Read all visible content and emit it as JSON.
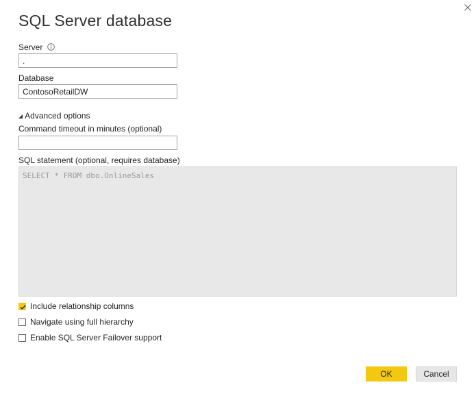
{
  "dialog": {
    "title": "SQL Server database"
  },
  "server": {
    "label": "Server",
    "value": "."
  },
  "database": {
    "label": "Database",
    "value": "ContosoRetailDW"
  },
  "advanced": {
    "toggle_label": "Advanced options",
    "timeout_label": "Command timeout in minutes (optional)",
    "timeout_value": "",
    "sql_label": "SQL statement (optional, requires database)",
    "sql_placeholder": "SELECT * FROM dbo.OnlineSales"
  },
  "options": [
    {
      "label": "Include relationship columns",
      "checked": true
    },
    {
      "label": "Navigate using full hierarchy",
      "checked": false
    },
    {
      "label": "Enable SQL Server Failover support",
      "checked": false
    }
  ],
  "buttons": {
    "ok_label": "OK",
    "cancel_label": "Cancel"
  },
  "colors": {
    "accent": "#f2c811",
    "sql_background": "#e8e8e8"
  }
}
